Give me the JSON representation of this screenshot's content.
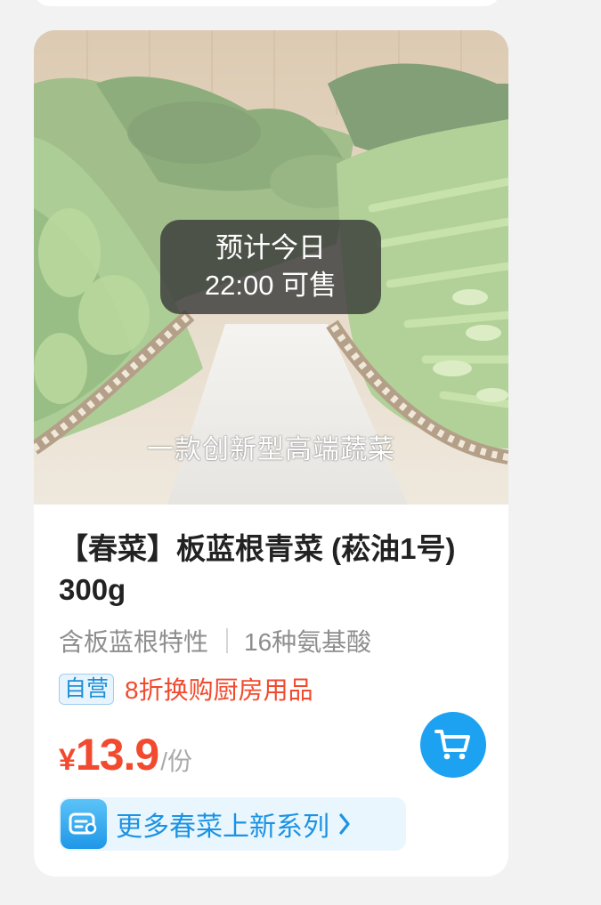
{
  "product": {
    "image_caption": "一款创新型高端蔬菜",
    "availability_line1": "预计今日",
    "availability_line2": "22:00 可售",
    "title": "【春菜】板蓝根青菜 (菘油1号) 300g",
    "features": [
      "含板蓝根特性",
      "16种氨基酸"
    ],
    "self_operated_tag": "自营",
    "promo_text": "8折换购厨房用品",
    "price": {
      "currency": "¥",
      "amount": "13.9",
      "unit": "/份"
    },
    "series_link": "更多春菜上新系列"
  },
  "icons": {
    "cart": "cart-icon",
    "series": "series-list-icon",
    "chevron": "chevron-right-icon"
  },
  "colors": {
    "price": "#f24a2e",
    "promo": "#f24a2e",
    "accent": "#1da2f2",
    "tag_border": "#9fcdef"
  }
}
